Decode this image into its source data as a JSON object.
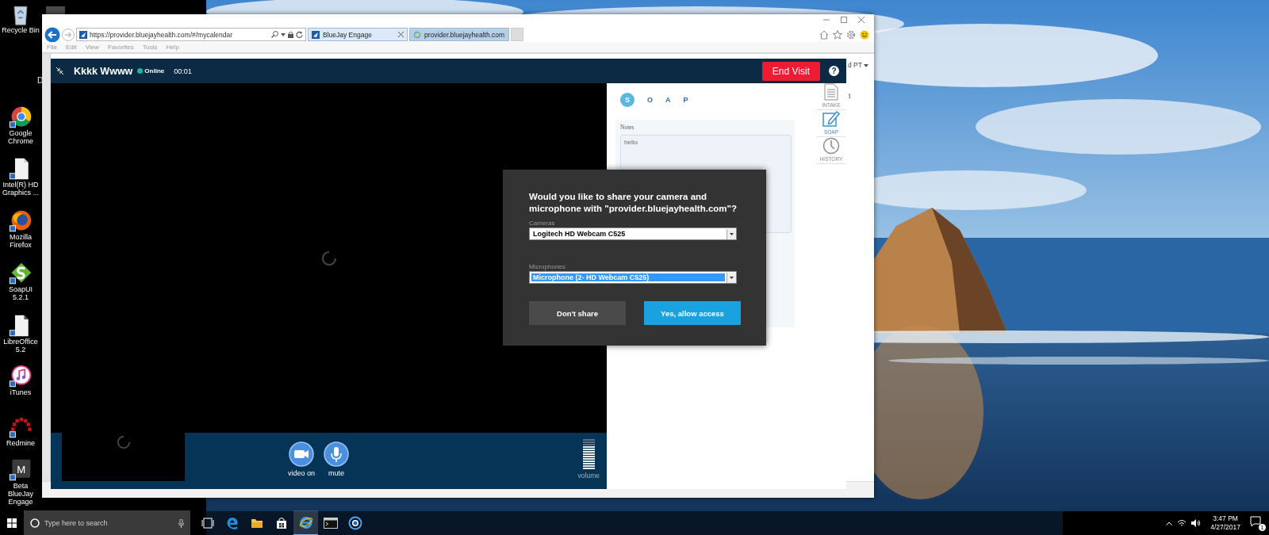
{
  "desktop": {
    "icons": [
      {
        "label": "Recycle Bin",
        "kind": "recycle"
      },
      {
        "label": "Google Chrome",
        "kind": "chrome"
      },
      {
        "label": "Intel(R) HD Graphics ...",
        "kind": "document"
      },
      {
        "label": "Mozilla Firefox",
        "kind": "firefox"
      },
      {
        "label": "SoapUI 5.2.1",
        "kind": "soapui"
      },
      {
        "label": "LibreOffice 5.2",
        "kind": "libreoffice"
      },
      {
        "label": "iTunes",
        "kind": "itunes"
      },
      {
        "label": "Redmine",
        "kind": "redmine"
      },
      {
        "label": "Beta BlueJay Engage",
        "kind": "letter",
        "letter": "M"
      }
    ],
    "hidden_label": "D"
  },
  "browser": {
    "address": "https://provider.bluejayhealth.com/#/mycalendar",
    "tabs": [
      {
        "label": "BlueJay Engage",
        "selected": true
      },
      {
        "label": "provider.bluejayhealth.com",
        "selected": false
      }
    ],
    "menu": [
      "File",
      "Edit",
      "View",
      "Favorites",
      "Tools",
      "Help"
    ],
    "page_fragments": [
      "d PT",
      "t"
    ]
  },
  "visit": {
    "patient": "Kkkk Wwww",
    "status": "Online",
    "timer": "00:01",
    "end_button": "End Visit",
    "help": "?",
    "controls": [
      {
        "label": "video on",
        "kind": "video"
      },
      {
        "label": "mute",
        "kind": "mic"
      }
    ],
    "volume": {
      "label": "volume",
      "level": 0.77
    },
    "soap_tabs": [
      {
        "label": "S",
        "selected": true
      },
      {
        "label": "O",
        "selected": false
      },
      {
        "label": "A",
        "selected": false
      },
      {
        "label": "P",
        "selected": false
      }
    ],
    "notes_label": "Notes",
    "notes": "hello",
    "side_tabs": [
      {
        "label": "INTAKE",
        "kind": "document",
        "selected": false
      },
      {
        "label": "SOAP",
        "kind": "edit",
        "selected": true
      },
      {
        "label": "HISTORY",
        "kind": "clock",
        "selected": false
      }
    ]
  },
  "permission_dialog": {
    "question": "Would you like to share your camera and microphone with \"provider.bluejayhealth.com\"?",
    "cameras_label": "Cameras",
    "camera": {
      "value": "Logitech HD Webcam C525",
      "focused": false
    },
    "microphones_label": "Microphones",
    "microphone": {
      "value": "Microphone (2- HD Webcam C525)",
      "focused": true
    },
    "buttons": [
      {
        "label": "Don't share",
        "kind": "secondary"
      },
      {
        "label": "Yes, allow access",
        "kind": "primary"
      }
    ]
  },
  "taskbar": {
    "search_placeholder": "Type here to search",
    "apps": [
      {
        "kind": "taskview",
        "selected": false
      },
      {
        "kind": "edge",
        "selected": false
      },
      {
        "kind": "explorer",
        "selected": false
      },
      {
        "kind": "store",
        "selected": false
      },
      {
        "kind": "ie",
        "selected": true
      },
      {
        "kind": "terminal",
        "selected": false
      },
      {
        "kind": "app",
        "selected": false
      }
    ],
    "time": "3:47 PM",
    "date": "4/27/2017",
    "notifications": "1"
  }
}
